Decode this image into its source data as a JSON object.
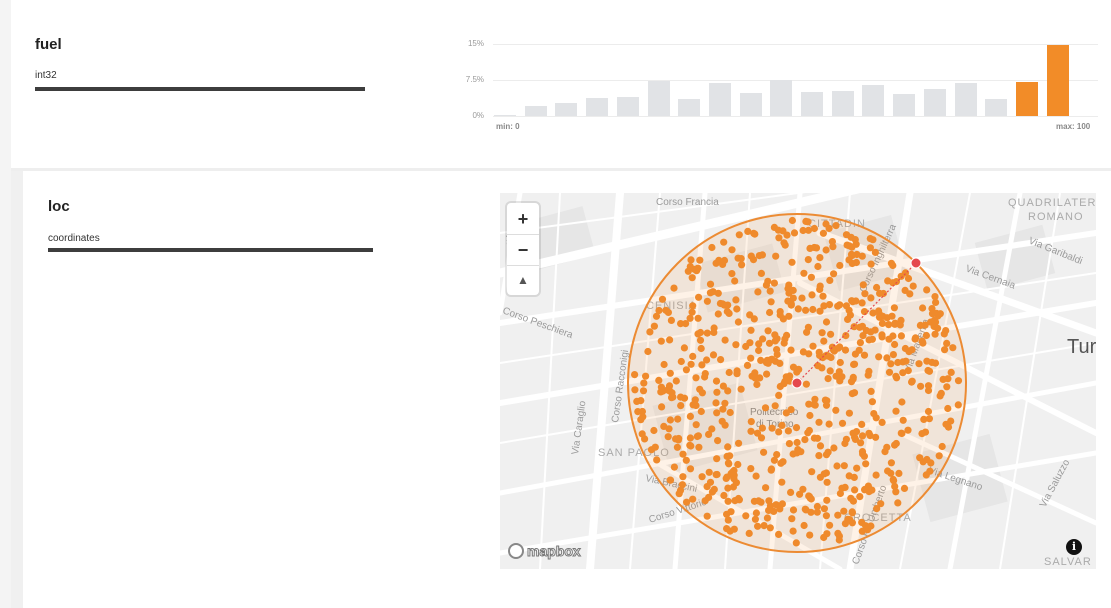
{
  "fields": [
    {
      "name": "fuel",
      "type": "int32"
    },
    {
      "name": "loc",
      "type": "coordinates"
    }
  ],
  "histogram": {
    "y_ticks": [
      "15%",
      "7.5%",
      "0%"
    ],
    "min_label": "min: 0",
    "max_label": "max: 100",
    "values": [
      0.1,
      2.0,
      2.8,
      3.8,
      4.0,
      7.3,
      3.5,
      6.8,
      4.8,
      7.6,
      5.1,
      5.3,
      6.4,
      4.5,
      5.7,
      6.8,
      3.5,
      7.0,
      14.8
    ],
    "highlighted_from_index": 17,
    "colors": {
      "bar": "#e1e3e6",
      "highlight": "#f28c28"
    }
  },
  "map": {
    "controls": {
      "zoom_in": "+",
      "zoom_out": "−",
      "compass": "▲"
    },
    "attribution": "mapbox",
    "info": "i",
    "colors": {
      "circle": "#ec8b33",
      "point": "#ef8a2c",
      "marker": "#e5484d"
    },
    "labels": {
      "corso_francia": "Corso Francia",
      "quadrilatero_1": "QUADRILATERO",
      "quadrilatero_2": "ROMANO",
      "cittadin": "CITTADIN",
      "via_garibaldi": "Via Garibaldi",
      "via_cernaia": "Via Cernaia",
      "corso_inghilterra": "Corso Inghilterra",
      "via_borgone": "Via Borgone",
      "corso_peschiera": "Corso Peschiera",
      "cenisia": "CENISIA",
      "corso_racconigi": "Corso Racconigi",
      "via_caraglio": "Via Caraglio",
      "politecnico_1": "Politecnico",
      "politecnico_2": "di Torino",
      "san_paolo": "SAN PAOLO",
      "via_braccini": "Via Braccini",
      "via_legnano": "Via Legnano",
      "crocetta": "CROCETTA",
      "via_saluzzo": "Via Saluzzo",
      "salvario": "SALVAR",
      "city": "Tur",
      "corso_vittorio": "Corso Vittorio",
      "via_magenta": "Via Magenta",
      "corso_re_umberto": "Corso Re Umberto"
    }
  }
}
